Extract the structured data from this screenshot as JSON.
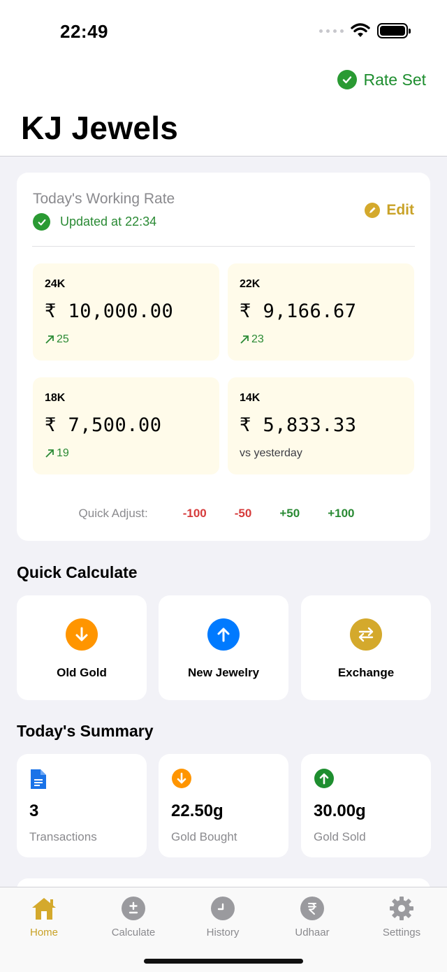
{
  "status_bar": {
    "time": "22:49"
  },
  "header": {
    "rate_status": "Rate Set",
    "title": "KJ Jewels"
  },
  "rate_card": {
    "title": "Today's Working Rate",
    "updated": "Updated at 22:34",
    "edit_label": "Edit",
    "karats": [
      {
        "label": "24K",
        "price": "₹ 10,000.00",
        "change": "25"
      },
      {
        "label": "22K",
        "price": "₹ 9,166.67",
        "change": "23"
      },
      {
        "label": "18K",
        "price": "₹ 7,500.00",
        "change": "19"
      },
      {
        "label": "14K",
        "price": "₹ 5,833.33",
        "note": "vs yesterday"
      }
    ],
    "quick_adjust": {
      "label": "Quick Adjust:",
      "options": [
        "-100",
        "-50",
        "+50",
        "+100"
      ]
    }
  },
  "quick_calculate": {
    "title": "Quick Calculate",
    "actions": [
      {
        "label": "Old Gold",
        "icon": "arrow-down-icon",
        "color": "#ff9500"
      },
      {
        "label": "New Jewelry",
        "icon": "arrow-up-icon",
        "color": "#007aff"
      },
      {
        "label": "Exchange",
        "icon": "exchange-icon",
        "color": "#d4a92c"
      }
    ]
  },
  "summary": {
    "title": "Today's Summary",
    "items": [
      {
        "value": "3",
        "label": "Transactions",
        "icon": "document-icon"
      },
      {
        "value": "22.50g",
        "label": "Gold Bought",
        "icon": "arrow-down-icon"
      },
      {
        "value": "30.00g",
        "label": "Gold Sold",
        "icon": "arrow-up-icon"
      }
    ]
  },
  "tabs": [
    {
      "label": "Home",
      "icon": "home-icon",
      "active": true
    },
    {
      "label": "Calculate",
      "icon": "plus-minus-icon"
    },
    {
      "label": "History",
      "icon": "clock-icon"
    },
    {
      "label": "Udhaar",
      "icon": "rupee-icon"
    },
    {
      "label": "Settings",
      "icon": "gear-icon"
    }
  ],
  "colors": {
    "accent_gold": "#c9a227",
    "positive": "#2a8a34",
    "negative": "#d63b3b",
    "card_bg": "#fffbea"
  }
}
